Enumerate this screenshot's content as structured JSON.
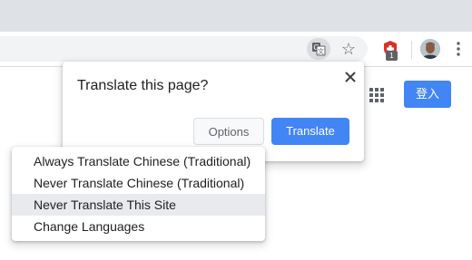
{
  "bubble": {
    "title": "Translate this page?",
    "options_label": "Options",
    "translate_label": "Translate"
  },
  "options_menu": {
    "items": [
      "Always Translate Chinese (Traditional)",
      "Never Translate Chinese (Traditional)",
      "Never Translate This Site",
      "Change Languages"
    ],
    "highlighted_item": "Never Translate This Site"
  },
  "toolbar": {
    "extension_badge": "1",
    "icons": [
      "translate-icon",
      "bookmark-star-icon",
      "shield-extension-icon",
      "profile-avatar",
      "kebab-menu-icon"
    ]
  },
  "page": {
    "signin_label": "登入",
    "apps_icon": "apps-grid-icon"
  },
  "colors": {
    "accent": "#4285f4",
    "tabstrip": "#dee1e6",
    "omnibox": "#f1f3f4",
    "extension_red": "#d93025",
    "highlight": "#e8eaed"
  }
}
